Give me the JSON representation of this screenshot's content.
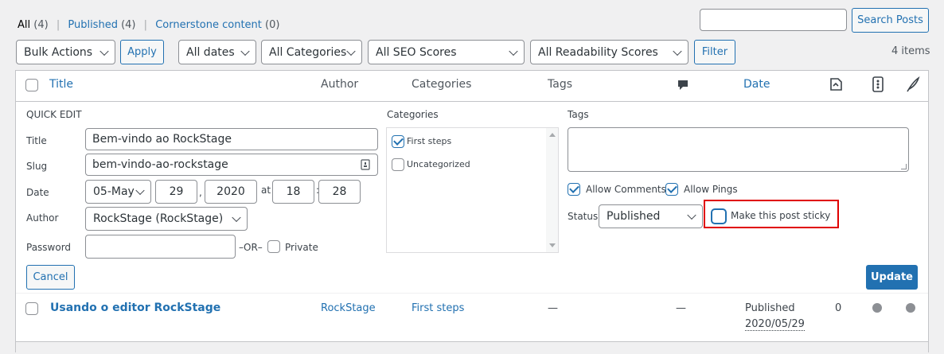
{
  "filters_nav": {
    "all": "All",
    "all_count": "(4)",
    "published": "Published",
    "published_count": "(4)",
    "cornerstone": "Cornerstone content",
    "cornerstone_count": "(0)",
    "sep": "|"
  },
  "search": {
    "value": "",
    "button": "Search Posts"
  },
  "toolbar": {
    "bulk_actions": "Bulk Actions",
    "apply": "Apply",
    "dates": "All dates",
    "categories": "All Categories",
    "seo": "All SEO Scores",
    "readability": "All Readability Scores",
    "filter": "Filter",
    "items": "4 items"
  },
  "columns": {
    "title": "Title",
    "author": "Author",
    "categories": "Categories",
    "tags": "Tags",
    "date": "Date",
    "icons": [
      "comment-icon",
      "seo-links-icon",
      "readability-icon",
      "feather-icon"
    ]
  },
  "quick_edit": {
    "heading": "QUICK EDIT",
    "title_label": "Title",
    "title_value": "Bem-vindo ao RockStage",
    "slug_label": "Slug",
    "slug_value": "bem-vindo-ao-rockstage",
    "date_label": "Date",
    "month": "05-May",
    "day": "29",
    "comma": ",",
    "year": "2020",
    "at": "at",
    "hour": "18",
    "colon": ":",
    "minute": "28",
    "author_label": "Author",
    "author_value": "RockStage (RockStage)",
    "password_label": "Password",
    "password_value": "",
    "or": "–OR–",
    "private": "Private",
    "categories_label": "Categories",
    "category_options": [
      {
        "label": "First steps",
        "checked": true
      },
      {
        "label": "Uncategorized",
        "checked": false
      }
    ],
    "tags_label": "Tags",
    "tags_value": "",
    "allow_comments": "Allow Comments",
    "allow_pings": "Allow Pings",
    "status_label": "Status",
    "status_value": "Published",
    "sticky": "Make this post sticky",
    "cancel": "Cancel",
    "update": "Update"
  },
  "rows": [
    {
      "title": "Usando o editor RockStage",
      "author": "RockStage",
      "categories": "First steps",
      "tags": "—",
      "comments": "—",
      "date_status": "Published",
      "date": "2020/05/29",
      "links": "0"
    }
  ]
}
